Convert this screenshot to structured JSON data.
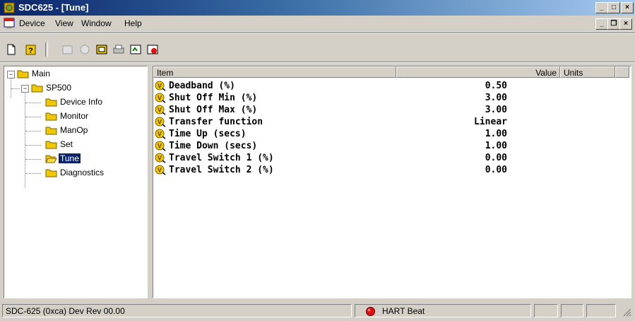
{
  "window": {
    "title": "SDC625 - [Tune]",
    "minimize": "_",
    "maximize": "□",
    "close": "×"
  },
  "menu": {
    "items": [
      "Device",
      "View",
      "Window",
      "Help"
    ],
    "mdi_min": "_",
    "mdi_restore": "❐",
    "mdi_close": "×"
  },
  "toolbar": {
    "icons": [
      "new-icon",
      "hart-icon",
      "disabled-icon",
      "disabled-icon",
      "device-icon",
      "print-icon",
      "refresh-icon",
      "stop-icon"
    ]
  },
  "tree": {
    "root": "Main",
    "device": "SP500",
    "children": [
      "Device Info",
      "Monitor",
      "ManOp",
      "Set",
      "Tune",
      "Diagnostics"
    ],
    "selected": "Tune"
  },
  "list": {
    "columns": [
      "Item",
      "Value",
      "Units"
    ],
    "rows": [
      {
        "item": "Deadband (%)",
        "value": "0.50"
      },
      {
        "item": "Shut Off Min (%)",
        "value": "3.00"
      },
      {
        "item": "Shut Off Max (%)",
        "value": "3.00"
      },
      {
        "item": "Transfer function",
        "value": "Linear"
      },
      {
        "item": "Time Up (secs)",
        "value": "1.00"
      },
      {
        "item": "Time Down (secs)",
        "value": "1.00"
      },
      {
        "item": "Travel Switch 1 (%)",
        "value": "0.00"
      },
      {
        "item": "Travel Switch 2 (%)",
        "value": "0.00"
      }
    ]
  },
  "status": {
    "device": "SDC-625  (0xca)  Dev Rev 00.00",
    "hart": "HART Beat",
    "hart_color": "#e01010"
  },
  "colors": {
    "titlebar_start": "#0a246a",
    "titlebar_end": "#a6caf0",
    "selection": "#0a246a",
    "folder": "#f0c800"
  }
}
